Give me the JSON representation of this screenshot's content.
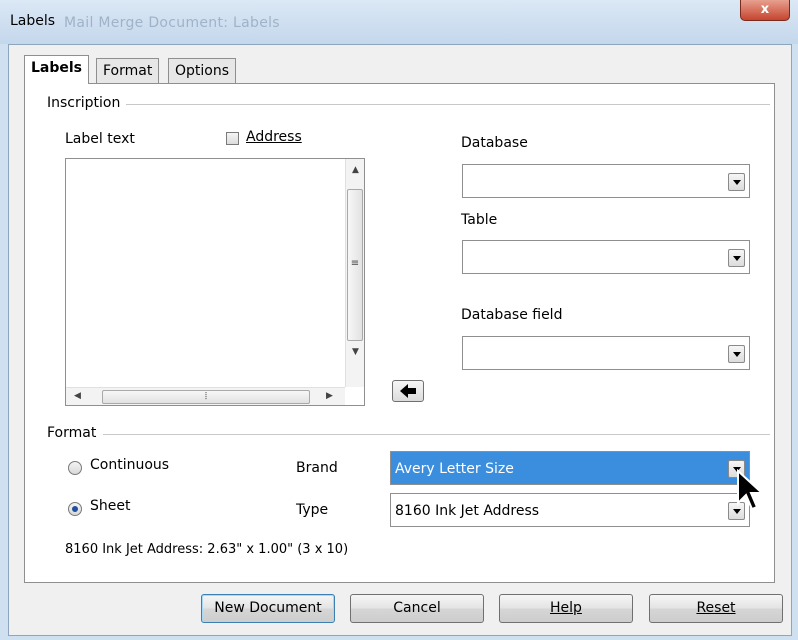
{
  "window": {
    "title": "Labels",
    "background_title": "Mail Merge Document: Labels",
    "close_glyph": "x"
  },
  "tabs": [
    {
      "label": "Labels",
      "active": true
    },
    {
      "label": "Format",
      "active": false
    },
    {
      "label": "Options",
      "active": false
    }
  ],
  "inscription": {
    "group_label": "Inscription",
    "label_text": "Label text",
    "address_checkbox": {
      "label": "Address",
      "checked": false
    },
    "label_text_value": ""
  },
  "database": {
    "database_label": "Database",
    "database_value": "",
    "table_label": "Table",
    "table_value": "",
    "field_label": "Database field",
    "field_value": ""
  },
  "format": {
    "group_label": "Format",
    "continuous_label": "Continuous",
    "sheet_label": "Sheet",
    "selected": "Sheet",
    "brand_label": "Brand",
    "brand_value": "Avery Letter Size",
    "type_label": "Type",
    "type_value": "8160 Ink Jet Address",
    "info_text": "8160 Ink Jet Address: 2.63\" x 1.00\" (3 x 10)"
  },
  "buttons": {
    "new_document": "New Document",
    "cancel": "Cancel",
    "help": "Help",
    "reset": "Reset"
  },
  "icons": {
    "insert_arrow": "left-arrow-icon",
    "scroll_grip": "grip-icon",
    "mouse_cursor": "cursor-icon"
  },
  "colors": {
    "selection": "#3b8ede",
    "close_button": "#c6452f"
  }
}
